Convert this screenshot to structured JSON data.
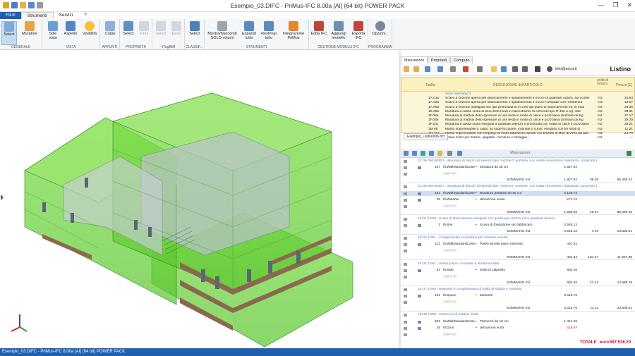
{
  "title_bar": {
    "title": "Esempio_03.DIFC - PriMus-IFC  8.00a [AI]  (64 bit)  POWER PACK",
    "win_min": "—",
    "win_max": "❐",
    "win_close": "✕"
  },
  "tabs": [
    "FILE",
    "Strumenti",
    "Servizi",
    "?"
  ],
  "ribbon": {
    "groups": [
      {
        "label": "GENERALE",
        "buttons": [
          "Select",
          "Muratore"
        ]
      },
      {
        "label": "VISTA",
        "buttons": [
          "Stile vista",
          "Aspetto",
          "Visibilità"
        ]
      },
      {
        "label": "APPUNTI",
        "buttons": [
          "Copia"
        ]
      },
      {
        "label": "PROPRIETÀ",
        "buttons": [
          "Select",
          "Edita"
        ]
      },
      {
        "label": "#TagBIM",
        "buttons": [
          "Select",
          "Edita"
        ]
      },
      {
        "label": "CLASSIF...",
        "buttons": [
          "Select"
        ]
      },
      {
        "label": "STRUMENTI",
        "buttons": [
          "Mostra/Nascondi SOLO volumi",
          "Espandi tutto",
          "Restringi tutto",
          "Integrazione PriMus"
        ]
      },
      {
        "label": "GESTIONE MODELLI IFC",
        "buttons": [
          "Edita IFC",
          "Aggiungi modello",
          "Esporta IFC"
        ]
      },
      {
        "label": "PROGRAMMA",
        "buttons": [
          "Opzioni..."
        ]
      }
    ]
  },
  "right_tabs": [
    "Misurazioni",
    "Proprietà",
    "Computo"
  ],
  "right_toolbar": {
    "email": "info@acca.it",
    "listino": "Listino"
  },
  "price_list": {
    "headers": {
      "tariffa": "Tariffa",
      "descr": "DESCRIZIONE dell'ARTICOLO",
      "unita": "unità di misura",
      "prezzo": "Prezzo [1]"
    },
    "rows": [
      {
        "code": "",
        "desc": "Voce riservata(?)",
        "um": "",
        "price": ""
      },
      {
        "code": "1A.01a",
        "desc": "Scavo a sezione aperta per sbancamento e splateamento in rocce di qualsiasi natura, sia sciolte",
        "um": "m3",
        "price": "24.63"
      },
      {
        "code": "1A.02b",
        "desc": "Scavo a sezione aperta per sbancamento e splateamento in rocce compatte con resistenza",
        "um": "m3",
        "price": "16.07"
      },
      {
        "code": "1A.06a",
        "desc": "Scavo a sezione obbligata fino alla profondità di m 2,00 dal piano di sbancamento ed, in man",
        "um": "m3",
        "price": "28.85"
      },
      {
        "code": "1E.06a",
        "desc": "Muratura a cassa vuota di blocchetti forati in calcestruzzo di cemento tipo R 425 a Kg. 150",
        "um": "m2",
        "price": "33.31"
      },
      {
        "code": "1F.08a",
        "desc": "Muratura di mattoni dello spessore di una testa in malta di calce e pozzolana (formata da Kg",
        "um": "m2",
        "price": "27.17"
      },
      {
        "code": "1F.08b",
        "desc": "Muratura di mattoni dello spessore di una testa in malta di calce e pozzolana (formata da Kg",
        "um": "m2",
        "price": "29.29"
      },
      {
        "code": "1P.14c",
        "desc": "Muratura a cassa vuota eseguita a qualsiasi altezza e profondità con malta di calce e pozzolana",
        "um": "m2",
        "price": "28.21"
      },
      {
        "code": "1M.05",
        "desc": "Manto impermeabile a caldo, su superfici piane, inclinate o curve, eseguito con tre strati di",
        "um": "m2",
        "price": "11.01"
      },
      {
        "code": "1M.11a",
        "desc": "Manto impermeabile con l'impiego di manti bituminosi armati con tessuto di fibre di vetro ad alta",
        "um": "m2",
        "price": "24.70"
      },
      {
        "code": "1P.02c",
        "desc": "Solaio misto per fissato...pagliato...fornitura e fissaggio...",
        "um": "m2",
        "price": "—"
      }
    ],
    "tab_label": "Esempio_Listino006.dcf"
  },
  "measure_toolbar_label": "Misurazioni",
  "measure_rows": [
    {
      "type": "art",
      "text": "1C.06.090.0030.b - Muratura di blocchi di laterizio tipo \"svizzero\" portante, con malta cementizia o bastarda, composto (..."
    },
    {
      "type": "item",
      "n": "157",
      "elem": "IfcWallStandardCase",
      "desc": "Muratura da 30 cm",
      "q": "1.827.92"
    },
    {
      "type": "add",
      "text": "Aggiungi"
    },
    {
      "type": "som",
      "label": "SOMMANO m2",
      "q": "1.827.92",
      "p": "36.28",
      "t": "66.335.22"
    },
    {
      "type": "art",
      "text": "1C.06.090.0030.c - Muratura di blocchi di laterizio tipo \"svizzero\" portante, con malta cementizia o bastarda, composto (..."
    },
    {
      "type": "sel",
      "n": "181",
      "elem": "IfcWallStandardCase",
      "desc": "Muratura portante da 40 cm",
      "q": "2.108.73"
    },
    {
      "type": "item",
      "n": "38",
      "elem": "IfcWindow",
      "desc": "detrazione vuoto",
      "q": "-272.18",
      "neg": true
    },
    {
      "type": "add",
      "text": "Aggiungi"
    },
    {
      "type": "som",
      "label": "SOMMANO m2",
      "q": "1.836.55",
      "p": "46.44",
      "t": "85.289.45"
    },
    {
      "type": "art",
      "text": "1E.01.1.003 - Scavo di sbancamento eseguito con qualunque mezzo ed in qualsiasi terreno"
    },
    {
      "type": "item",
      "n": "1",
      "elem": "IfcSite",
      "desc": "Scavo di fondazione sito fabbricato",
      "q": "2.546.12"
    },
    {
      "type": "som",
      "label": "SOMMANO m3",
      "q": "2.546.12",
      "p": "4.19",
      "t": "10.680.81"
    },
    {
      "type": "art",
      "text": "1E.03.1.001 - Conglomerato cementizio per strutture armate"
    },
    {
      "type": "item",
      "n": "112",
      "elem": "IfcWallStandardCase",
      "desc": "Pareti armate piano interrato",
      "q": "401.34"
    },
    {
      "type": "add",
      "text": "Aggiungi"
    },
    {
      "type": "som",
      "label": "SOMMANO m3",
      "q": "401.34",
      "p": "104.47",
      "t": "41.927.99"
    },
    {
      "type": "art",
      "text": "1E.04.1.001 - Solaio piano o inclinato a struttura mista"
    },
    {
      "type": "item",
      "n": "52",
      "elem": "IfcSlab",
      "desc": "Solai di calpestio",
      "q": "692.26"
    },
    {
      "type": "add",
      "text": "Aggiungi"
    },
    {
      "type": "som",
      "label": "SOMMANO m2",
      "q": "692.26",
      "p": "21.22",
      "t": "14.689.76"
    },
    {
      "type": "art",
      "text": "1E.07.1.005 - Massetto in conglomerato di malta di sabbia e cemento"
    },
    {
      "type": "item",
      "n": "132",
      "elem": "IfcSpace",
      "desc": "Massetti",
      "q": "2.115.76"
    },
    {
      "type": "add",
      "text": "Aggiungi"
    },
    {
      "type": "som",
      "label": "SOMMANO m2",
      "q": "2.115.76",
      "p": "11.12",
      "t": "23.505.01"
    },
    {
      "type": "art",
      "text": "1E.08.1.003 - Tramezzo di mattoni forati"
    },
    {
      "type": "item",
      "n": "623",
      "elem": "IfcWallStandardCase",
      "desc": "Tramezzi da 10 cm",
      "q": "1.414.26"
    },
    {
      "type": "item",
      "n": "25",
      "elem": "IfcDoor",
      "desc": "detrazione vuoti",
      "q": "-115.07",
      "neg": true
    },
    {
      "type": "add",
      "text": "Aggiungi"
    }
  ],
  "totale": {
    "label": "TOTALE",
    "currency": "euro",
    "value": "597.536.20"
  },
  "status": "Esempio_03.DIFC - PriMus-IFC  8.00a [AI]  (64 bit)  POWER PACK",
  "colors": {
    "accent": "#1f5fb0",
    "green": "#6cd33f",
    "wall": "#8a6a4e"
  }
}
